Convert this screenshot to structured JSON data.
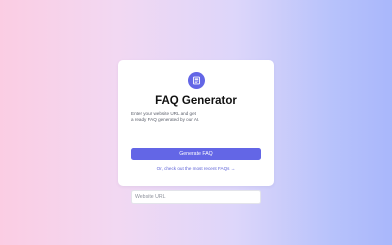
{
  "form": {
    "title": "FAQ Generator",
    "description_lines": [
      "Enter your website URL and get",
      "a ready FAQ generated by our AI."
    ],
    "url_placeholder": "Website URL",
    "url_value": "",
    "submit_label": "Generate FAQ",
    "recent_link": "Or, check out the most recent FAQs →"
  },
  "icons": {
    "logo": "document-icon"
  },
  "colors": {
    "accent": "#6366e6",
    "background_left": "#fbcde3",
    "background_right": "#a9b7fb",
    "card": "#ffffff"
  }
}
